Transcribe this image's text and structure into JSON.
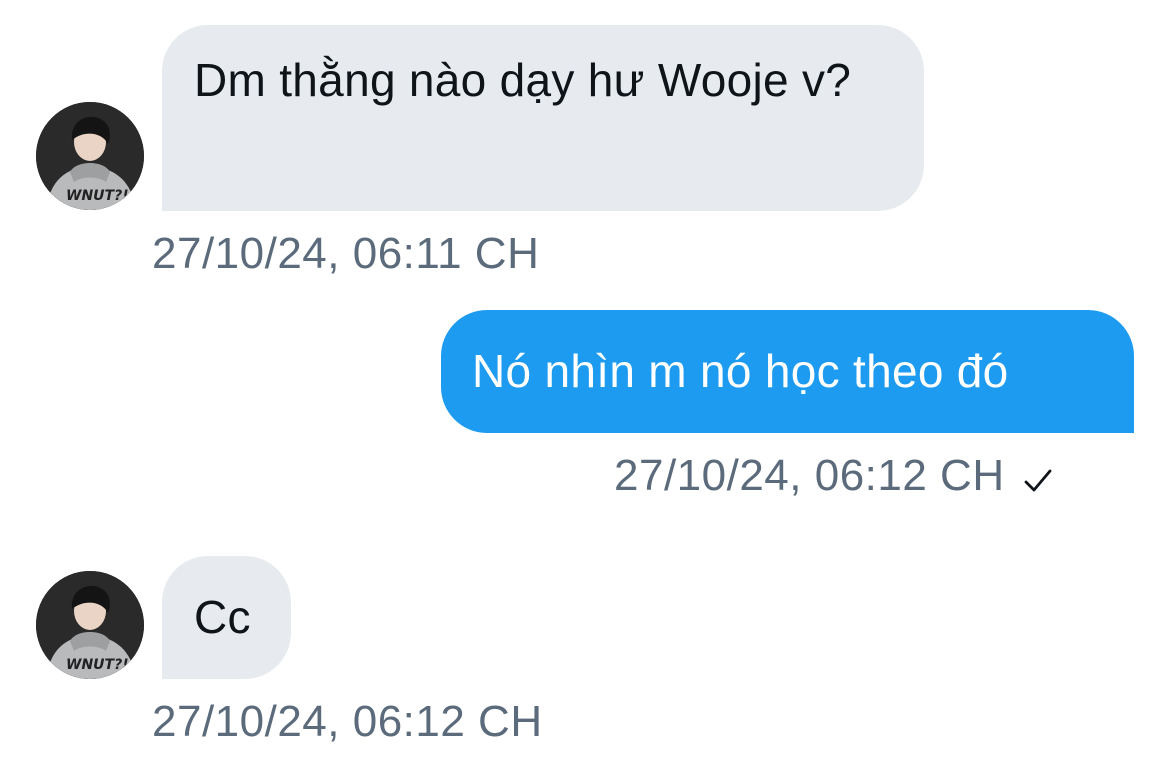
{
  "conversation": {
    "messages": [
      {
        "direction": "incoming",
        "text": "Dm thằng nào dạy hư Wooje v?",
        "timestamp": "27/10/24, 06:11 CH",
        "avatar_icon": "user-avatar-icon"
      },
      {
        "direction": "outgoing",
        "text": "Nó nhìn m nó học theo đó",
        "timestamp": "27/10/24, 06:12 CH",
        "status_icon": "sent-check-icon"
      },
      {
        "direction": "incoming",
        "text": "Cc",
        "timestamp": "27/10/24, 06:12 CH",
        "avatar_icon": "user-avatar-icon"
      }
    ]
  },
  "colors": {
    "incoming_bubble": "#e7ebf0",
    "outgoing_bubble": "#1d9bf0",
    "timestamp_text": "#5b6b7b",
    "message_text": "#0f1419"
  }
}
